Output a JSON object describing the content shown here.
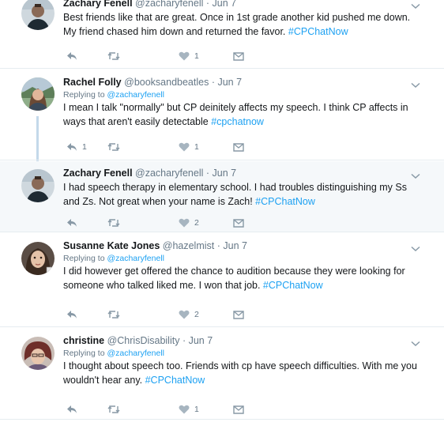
{
  "tweets": [
    {
      "name": "Zachary Fenell",
      "handle": "@zacharyfenell",
      "dot": "·",
      "date": "Jun 7",
      "replying_prefix": "",
      "replying_to": "",
      "text_pre": "Best friends like that are great. Once in 1st grade another kid pushed me down. My friend chased him down and returned the favor. ",
      "hashtag": "#CPChatNow",
      "text_post": "",
      "reply_count": "",
      "retweet_count": "",
      "like_count": "1",
      "avatar": "avatar-photo-zachary"
    },
    {
      "name": "Rachel Folly",
      "handle": "@booksandbeatles",
      "dot": "·",
      "date": "Jun 7",
      "replying_prefix": "Replying to ",
      "replying_to": "@zacharyfenell",
      "text_pre": "I mean I talk \"normally\" but CP deinitely affects my speech. I think CP affects in ways that aren't easily detectable ",
      "hashtag": "#cpchatnow",
      "text_post": "",
      "reply_count": "1",
      "retweet_count": "",
      "like_count": "1",
      "avatar": "avatar-photo-rachel"
    },
    {
      "name": "Zachary Fenell",
      "handle": "@zacharyfenell",
      "dot": "·",
      "date": "Jun 7",
      "replying_prefix": "",
      "replying_to": "",
      "text_pre": "I had speech therapy in elementary school. I had troubles distinguishing my Ss and Zs. Not great when your name is Zach! ",
      "hashtag": "#CPChatNow",
      "text_post": "",
      "reply_count": "",
      "retweet_count": "",
      "like_count": "2",
      "avatar": "avatar-photo-zachary"
    },
    {
      "name": "Susanne Kate Jones",
      "handle": "@hazelmist",
      "dot": "·",
      "date": "Jun 7",
      "replying_prefix": "Replying to ",
      "replying_to": "@zacharyfenell",
      "text_pre": "I did however get offered the chance to audition because they were looking for someone who talked liked me. I won that job. ",
      "hashtag": "#CPChatNow",
      "text_post": "",
      "reply_count": "",
      "retweet_count": "",
      "like_count": "2",
      "avatar": "avatar-photo-susanne"
    },
    {
      "name": "christine",
      "handle": "@ChrisDisability",
      "dot": "·",
      "date": "Jun 7",
      "replying_prefix": "Replying to ",
      "replying_to": "@zacharyfenell",
      "text_pre": "I thought about speech too. Friends with cp have speech difficulties. With me you wouldn't hear any. ",
      "hashtag": "#CPChatNow",
      "text_post": "",
      "reply_count": "",
      "retweet_count": "",
      "like_count": "1",
      "avatar": "avatar-photo-christine"
    }
  ],
  "icons": {
    "reply": "reply-icon",
    "retweet": "retweet-icon",
    "like": "heart-icon",
    "dm": "direct-message-icon",
    "more": "chevron-down-icon"
  },
  "colors": {
    "link": "#1da1f2",
    "muted": "#657786",
    "action": "#8899a6",
    "highlight_bg": "#f5f8fa",
    "thread_line": "#c4d9ea"
  }
}
